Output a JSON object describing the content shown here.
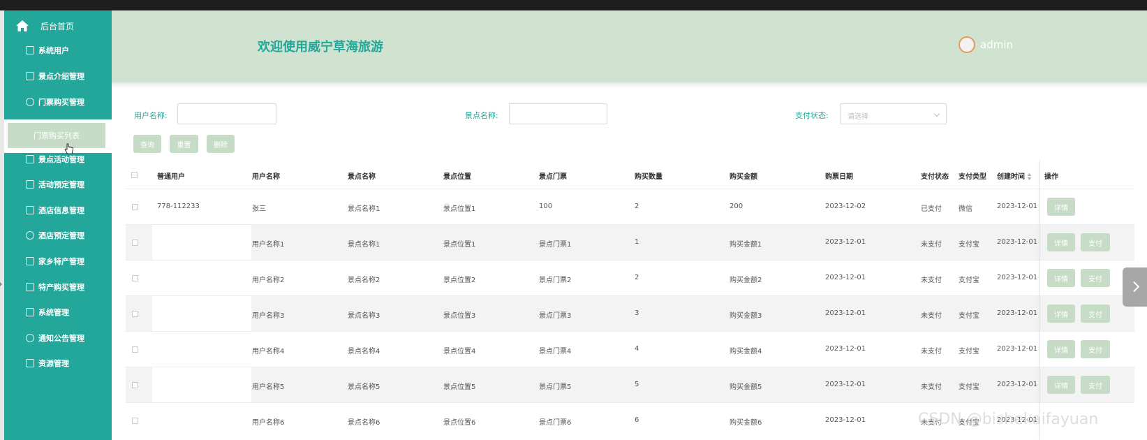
{
  "sidebar": {
    "home_label": "后台首页",
    "items": [
      {
        "label": "系统用户",
        "icon": "user-doc-icon"
      },
      {
        "label": "景点介绍管理",
        "icon": "card-icon"
      },
      {
        "label": "门票购买管理",
        "icon": "cloud-icon"
      },
      {
        "label": "景点活动管理",
        "icon": "edit-icon"
      },
      {
        "label": "活动预定管理",
        "icon": "card-icon"
      },
      {
        "label": "酒店信息管理",
        "icon": "edit-icon"
      },
      {
        "label": "酒店预定管理",
        "icon": "cloud-icon"
      },
      {
        "label": "家乡特产管理",
        "icon": "card-icon"
      },
      {
        "label": "特产购买管理",
        "icon": "user-doc-icon"
      },
      {
        "label": "系统管理",
        "icon": "edit-icon"
      },
      {
        "label": "通知公告管理",
        "icon": "cloud-icon"
      },
      {
        "label": "资源管理",
        "icon": "edit-icon"
      }
    ],
    "active_sub": "门票购买列表"
  },
  "header": {
    "welcome": "欢迎使用威宁草海旅游",
    "username": "admin"
  },
  "filters": {
    "user_label": "用户名称:",
    "user_value": "",
    "spot_label": "景点名称:",
    "spot_value": "",
    "status_label": "支付状态:",
    "status_placeholder": "请选择"
  },
  "actions": {
    "query": "查询",
    "reset": "重置",
    "delete": "删除"
  },
  "table": {
    "headers": [
      "普通用户",
      "用户名称",
      "景点名称",
      "景点位置",
      "景点门票",
      "购买数量",
      "购买金额",
      "购票日期",
      "支付状态",
      "支付类型",
      "创建时间",
      "操作"
    ],
    "rows": [
      {
        "user": "778-112233",
        "name": "张三",
        "spot": "景点名称1",
        "loc": "景点位置1",
        "ticket": "100",
        "qty": "2",
        "amount": "200",
        "date": "2023-12-02",
        "status": "已支付",
        "paytype": "微信",
        "created": "2023-12-01",
        "detail": "详情",
        "pay": ""
      },
      {
        "user": "",
        "name": "用户名称1",
        "spot": "景点名称1",
        "loc": "景点位置1",
        "ticket": "景点门票1",
        "qty": "1",
        "amount": "购买金额1",
        "date": "2023-12-01",
        "status": "未支付",
        "paytype": "支付宝",
        "created": "2023-12-01",
        "detail": "详情",
        "pay": "支付"
      },
      {
        "user": "",
        "name": "用户名称2",
        "spot": "景点名称2",
        "loc": "景点位置2",
        "ticket": "景点门票2",
        "qty": "2",
        "amount": "购买金额2",
        "date": "2023-12-01",
        "status": "未支付",
        "paytype": "支付宝",
        "created": "2023-12-01",
        "detail": "详情",
        "pay": "支付"
      },
      {
        "user": "",
        "name": "用户名称3",
        "spot": "景点名称3",
        "loc": "景点位置3",
        "ticket": "景点门票3",
        "qty": "3",
        "amount": "购买金额3",
        "date": "2023-12-01",
        "status": "未支付",
        "paytype": "支付宝",
        "created": "2023-12-01",
        "detail": "详情",
        "pay": "支付"
      },
      {
        "user": "",
        "name": "用户名称4",
        "spot": "景点名称4",
        "loc": "景点位置4",
        "ticket": "景点门票4",
        "qty": "4",
        "amount": "购买金额4",
        "date": "2023-12-01",
        "status": "未支付",
        "paytype": "支付宝",
        "created": "2023-12-01",
        "detail": "详情",
        "pay": "支付"
      },
      {
        "user": "",
        "name": "用户名称5",
        "spot": "景点名称5",
        "loc": "景点位置5",
        "ticket": "景点门票5",
        "qty": "5",
        "amount": "购买金额5",
        "date": "2023-12-01",
        "status": "未支付",
        "paytype": "支付宝",
        "created": "2023-12-01",
        "detail": "详情",
        "pay": "支付"
      },
      {
        "user": "",
        "name": "用户名称6",
        "spot": "景点名称6",
        "loc": "景点位置6",
        "ticket": "景点门票6",
        "qty": "6",
        "amount": "购买金额6",
        "date": "2023-12-01",
        "status": "未支付",
        "paytype": "支付宝",
        "created": "2023-12-01",
        "detail": "",
        "pay": ""
      }
    ]
  },
  "watermark": "CSDN @bishekaifayuan",
  "colors": {
    "sidebar_bg": "#22a79a",
    "header_bg": "#cfe3d0",
    "button_bg": "#c7dcc7",
    "accent_text": "#22a79a"
  }
}
